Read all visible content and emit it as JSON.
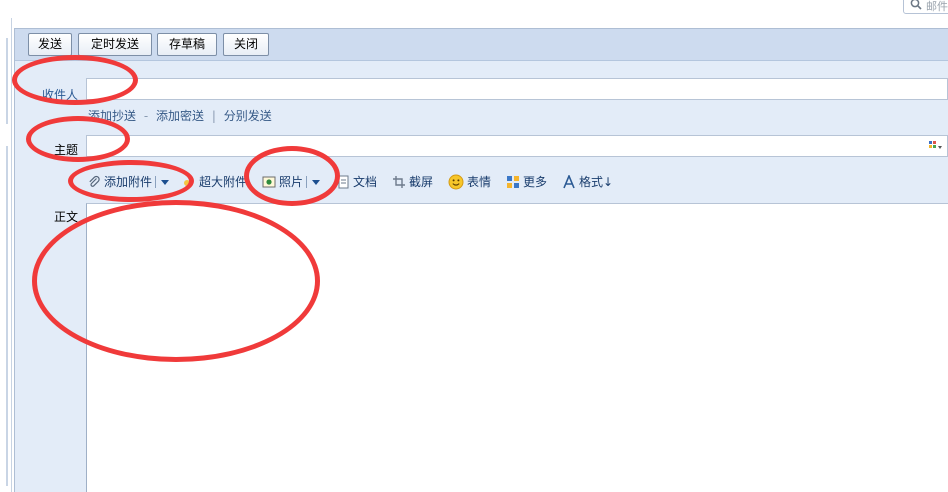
{
  "search": {
    "placeholder": "邮件"
  },
  "toolbar": {
    "send_label": "发送",
    "scheduled_send_label": "定时发送",
    "save_draft_label": "存草稿",
    "close_label": "关闭"
  },
  "compose": {
    "recipient_label": "收件人",
    "recipient_value": "",
    "cc_label": "添加抄送",
    "bcc_label": "添加密送",
    "separate_send_label": "分别发送",
    "link_dash": "-",
    "link_bar": "|",
    "subject_label": "主题",
    "subject_value": "",
    "body_label": "正文",
    "body_value": ""
  },
  "attachments": {
    "add_attachment_label": "添加附件",
    "large_attachment_label": "超大附件",
    "photo_label": "照片",
    "document_label": "文档",
    "screenshot_label": "截屏",
    "emoji_label": "表情",
    "more_label": "更多",
    "format_label": "格式↓"
  },
  "colors": {
    "annotation": "#f03a3a",
    "toolbar_bg": "#cddbef",
    "panel_bg": "#e3ecf8",
    "link": "#375a87"
  },
  "icons": {
    "search": "search-icon",
    "attachment": "paperclip-icon",
    "large_attachment": "large-attachment-icon",
    "photo": "photo-icon",
    "document": "document-icon",
    "screenshot": "screenshot-icon",
    "emoji": "smiley-icon",
    "more": "grid-icon",
    "format": "format-text-icon"
  }
}
